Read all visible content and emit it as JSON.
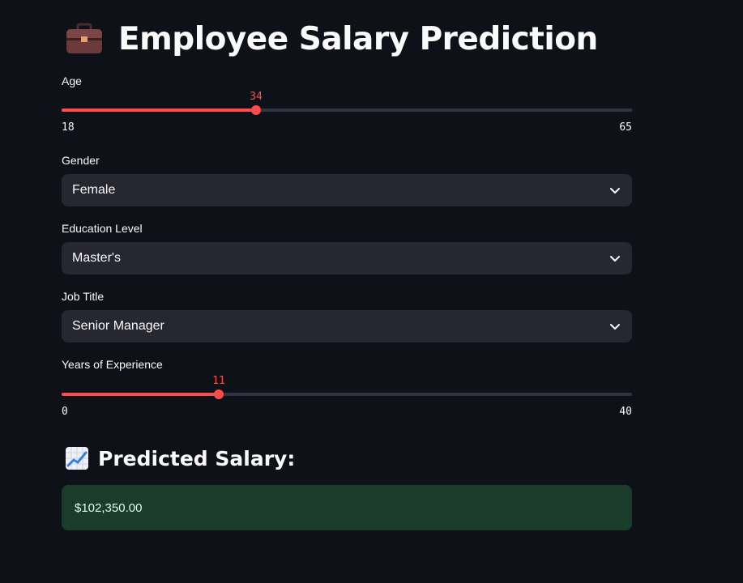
{
  "app": {
    "title": "Employee Salary Prediction",
    "title_icon": "briefcase-icon"
  },
  "form": {
    "age": {
      "label": "Age",
      "value": "34",
      "min": "18",
      "max": "65"
    },
    "gender": {
      "label": "Gender",
      "value": "Female"
    },
    "education": {
      "label": "Education Level",
      "value": "Master's"
    },
    "job_title": {
      "label": "Job Title",
      "value": "Senior Manager"
    },
    "experience": {
      "label": "Years of Experience",
      "value": "11",
      "min": "0",
      "max": "40"
    }
  },
  "result": {
    "heading": "Predicted Salary:",
    "heading_icon": "chart-increasing-icon",
    "value": "$102,350.00"
  },
  "colors": {
    "background": "#0e1117",
    "accent": "#ff4b4b",
    "input_bg": "#262730",
    "success_bg": "#1b3c28",
    "success_text": "#dffde9"
  }
}
